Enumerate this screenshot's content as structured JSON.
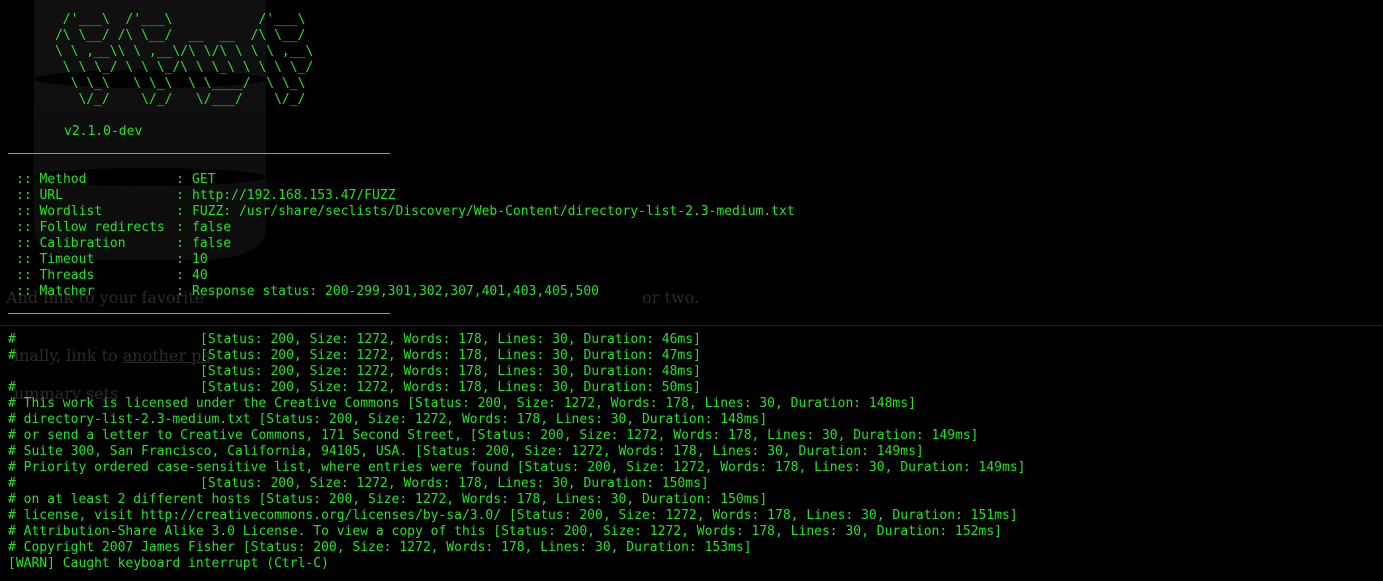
{
  "banner": {
    "ascii": [
      "       /'___\\  /'___\\           /'___\\",
      "      /\\ \\__/ /\\ \\__/  __  __  /\\ \\__/",
      "      \\ \\ ,__\\\\ \\ ,__\\/\\ \\/\\ \\ \\ \\ ,__\\",
      "       \\ \\ \\_/ \\ \\ \\_/\\ \\ \\_\\ \\ \\ \\ \\_/",
      "        \\ \\_\\   \\ \\_\\  \\ \\____/  \\ \\_\\",
      "         \\/_/    \\/_/   \\/___/    \\/_/"
    ],
    "version": "v2.1.0-dev"
  },
  "config": [
    {
      "key": ":: Method",
      "value": "GET"
    },
    {
      "key": ":: URL",
      "value": "http://192.168.153.47/FUZZ"
    },
    {
      "key": ":: Wordlist",
      "value": "FUZZ: /usr/share/seclists/Discovery/Web-Content/directory-list-2.3-medium.txt"
    },
    {
      "key": ":: Follow redirects",
      "value": "false"
    },
    {
      "key": ":: Calibration",
      "value": "false"
    },
    {
      "key": ":: Timeout",
      "value": "10"
    },
    {
      "key": ":: Threads",
      "value": "40"
    },
    {
      "key": ":: Matcher",
      "value": "Response status: 200-299,301,302,307,401,403,405,500"
    }
  ],
  "results": [
    {
      "prefix": "#",
      "status": "[Status: 200, Size: 1272, Words: 178, Lines: 30, Duration: 46ms]"
    },
    {
      "prefix": "#",
      "status": "[Status: 200, Size: 1272, Words: 178, Lines: 30, Duration: 47ms]"
    },
    {
      "prefix": "",
      "status": "[Status: 200, Size: 1272, Words: 178, Lines: 30, Duration: 48ms]"
    },
    {
      "prefix": "#",
      "status": "[Status: 200, Size: 1272, Words: 178, Lines: 30, Duration: 50ms]"
    }
  ],
  "result_lines": [
    "# This work is licensed under the Creative Commons [Status: 200, Size: 1272, Words: 178, Lines: 30, Duration: 148ms]",
    "# directory-list-2.3-medium.txt [Status: 200, Size: 1272, Words: 178, Lines: 30, Duration: 148ms]",
    "# or send a letter to Creative Commons, 171 Second Street, [Status: 200, Size: 1272, Words: 178, Lines: 30, Duration: 149ms]",
    "# Suite 300, San Francisco, California, 94105, USA. [Status: 200, Size: 1272, Words: 178, Lines: 30, Duration: 149ms]",
    "# Priority ordered case-sensitive list, where entries were found [Status: 200, Size: 1272, Words: 178, Lines: 30, Duration: 149ms]"
  ],
  "result_hash_line": {
    "prefix": "#",
    "status": "[Status: 200, Size: 1272, Words: 178, Lines: 30, Duration: 150ms]"
  },
  "result_lines_2": [
    "# on at least 2 different hosts [Status: 200, Size: 1272, Words: 178, Lines: 30, Duration: 150ms]",
    "# license, visit http://creativecommons.org/licenses/by-sa/3.0/ [Status: 200, Size: 1272, Words: 178, Lines: 30, Duration: 151ms]",
    "# Attribution-Share Alike 3.0 License. To view a copy of this [Status: 200, Size: 1272, Words: 178, Lines: 30, Duration: 152ms]",
    "# Copyright 2007 James Fisher [Status: 200, Size: 1272, Words: 178, Lines: 30, Duration: 153ms]"
  ],
  "warn": "[WARN] Caught keyboard interrupt (Ctrl-C)",
  "ghost_text": {
    "line1": "And link to your favorite",
    "line1b": "or two.",
    "line2": "inally, link to",
    "line2b": "another pa",
    "line3": "ummary sets"
  },
  "colors": {
    "text": "#24e224",
    "background": "#000000"
  }
}
